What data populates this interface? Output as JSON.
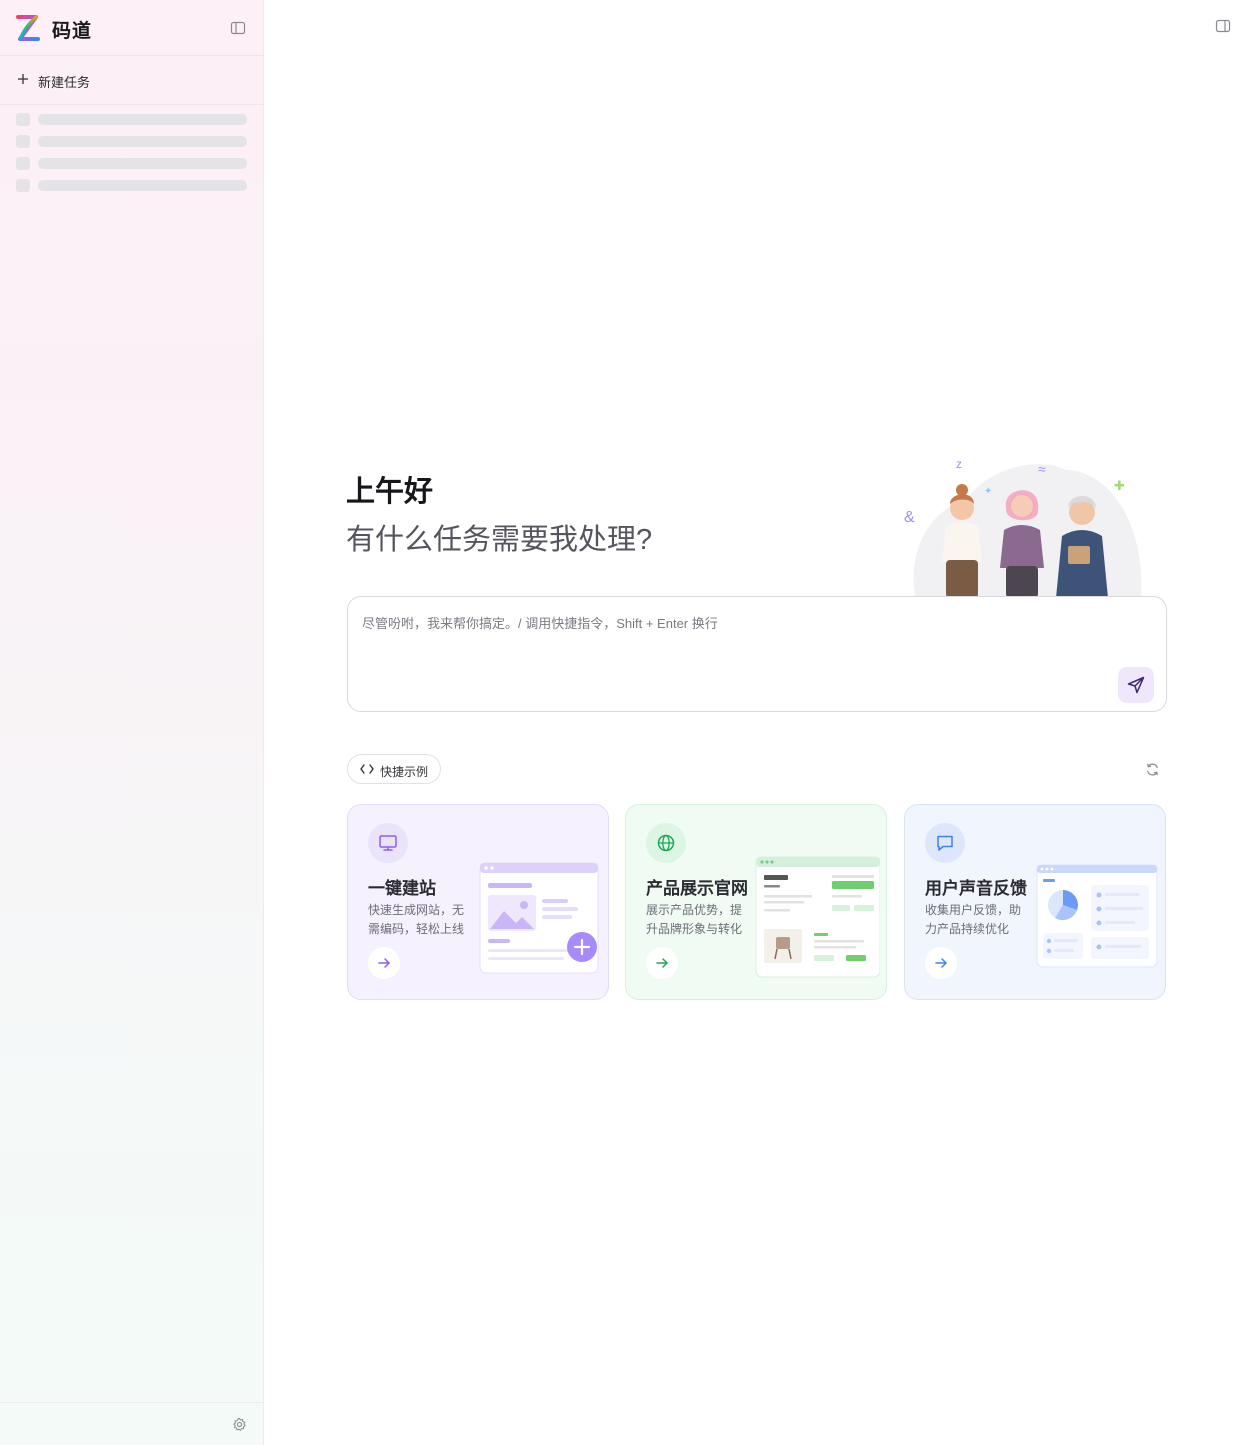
{
  "app": {
    "title": "码道"
  },
  "sidebar": {
    "new_task_label": "新建任务",
    "skeleton_rows": 4
  },
  "main": {
    "greeting": "上午好",
    "subheading": "有什么任务需要我处理?",
    "prompt": {
      "placeholder": "尽管吩咐，我来帮你搞定。/ 调用快捷指令，Shift + Enter 换行",
      "value": ""
    },
    "examples_label": "快捷示例",
    "cards": [
      {
        "title": "一键建站",
        "desc": "快速生成网站，无需编码，轻松上线",
        "icon": "monitor-icon",
        "accent": "#8b5cf6"
      },
      {
        "title": "产品展示官网",
        "desc": "展示产品优势，提升品牌形象与转化",
        "icon": "globe-icon",
        "accent": "#22a55a"
      },
      {
        "title": "用户声音反馈",
        "desc": "收集用户反馈，助力产品持续优化",
        "icon": "message-icon",
        "accent": "#3b82f6"
      }
    ]
  },
  "colors": {
    "brand_purple": "#7c3aed",
    "sidebar_top": "#fdf0f6",
    "sidebar_bottom": "#f3faf8"
  }
}
